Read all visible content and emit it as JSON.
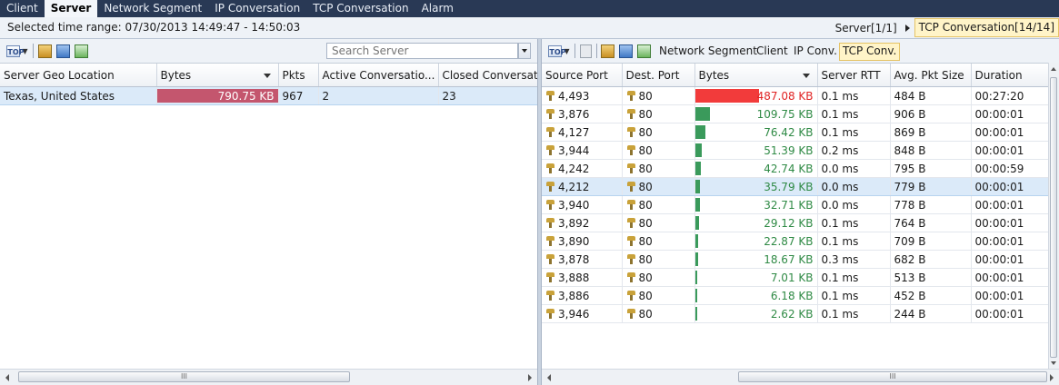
{
  "tabs": [
    {
      "label": "Client",
      "active": false
    },
    {
      "label": "Server",
      "active": true
    },
    {
      "label": "Network Segment",
      "active": false
    },
    {
      "label": "IP Conversation",
      "active": false
    },
    {
      "label": "TCP Conversation",
      "active": false
    },
    {
      "label": "Alarm",
      "active": false
    }
  ],
  "range_label": "Selected time range: 07/30/2013 14:49:47 - 14:50:03",
  "breadcrumbs": [
    "Server[1/1]",
    "TCP Conversation[14/14]"
  ],
  "left": {
    "search_placeholder": "Search Server",
    "columns": [
      "Server Geo Location",
      "Bytes",
      "Pkts",
      "Active Conversatio...",
      "Closed Conversations"
    ],
    "rows": [
      {
        "location": "Texas, United States",
        "bytes": "790.75 KB",
        "bytes_fraction": 1.0,
        "pkts": "967",
        "active": "2",
        "closed": "23"
      }
    ],
    "bar_color": "#c4566e",
    "hscroll_grip": "III"
  },
  "right": {
    "nav_tabs": [
      "Network Segment",
      "Client",
      "IP Conv.",
      "TCP Conv."
    ],
    "active_nav": "TCP Conv.",
    "columns": [
      "Source Port",
      "Dest. Port",
      "Bytes",
      "Server RTT",
      "Avg. Pkt Size",
      "Duration"
    ],
    "rows": [
      {
        "src": "4,493",
        "dst": "80",
        "bytes": "487.08 KB",
        "fraction": 1.0,
        "rtt": "0.1 ms",
        "avg": "484 B",
        "dur": "00:27:20",
        "highlight": true
      },
      {
        "src": "3,876",
        "dst": "80",
        "bytes": "109.75 KB",
        "fraction": 0.2253,
        "rtt": "0.1 ms",
        "avg": "906 B",
        "dur": "00:00:01"
      },
      {
        "src": "4,127",
        "dst": "80",
        "bytes": "76.42 KB",
        "fraction": 0.1569,
        "rtt": "0.1 ms",
        "avg": "869 B",
        "dur": "00:00:01"
      },
      {
        "src": "3,944",
        "dst": "80",
        "bytes": "51.39 KB",
        "fraction": 0.1055,
        "rtt": "0.2 ms",
        "avg": "848 B",
        "dur": "00:00:01"
      },
      {
        "src": "4,242",
        "dst": "80",
        "bytes": "42.74 KB",
        "fraction": 0.0877,
        "rtt": "0.0 ms",
        "avg": "795 B",
        "dur": "00:00:59"
      },
      {
        "src": "4,212",
        "dst": "80",
        "bytes": "35.79 KB",
        "fraction": 0.0735,
        "rtt": "0.0 ms",
        "avg": "779 B",
        "dur": "00:00:01",
        "selected": true
      },
      {
        "src": "3,940",
        "dst": "80",
        "bytes": "32.71 KB",
        "fraction": 0.0672,
        "rtt": "0.0 ms",
        "avg": "778 B",
        "dur": "00:00:01"
      },
      {
        "src": "3,892",
        "dst": "80",
        "bytes": "29.12 KB",
        "fraction": 0.0598,
        "rtt": "0.1 ms",
        "avg": "764 B",
        "dur": "00:00:01"
      },
      {
        "src": "3,890",
        "dst": "80",
        "bytes": "22.87 KB",
        "fraction": 0.047,
        "rtt": "0.1 ms",
        "avg": "709 B",
        "dur": "00:00:01"
      },
      {
        "src": "3,878",
        "dst": "80",
        "bytes": "18.67 KB",
        "fraction": 0.0383,
        "rtt": "0.3 ms",
        "avg": "682 B",
        "dur": "00:00:01"
      },
      {
        "src": "3,888",
        "dst": "80",
        "bytes": "7.01 KB",
        "fraction": 0.0144,
        "rtt": "0.1 ms",
        "avg": "513 B",
        "dur": "00:00:01"
      },
      {
        "src": "3,886",
        "dst": "80",
        "bytes": "6.18 KB",
        "fraction": 0.0127,
        "rtt": "0.1 ms",
        "avg": "452 B",
        "dur": "00:00:01"
      },
      {
        "src": "3,946",
        "dst": "80",
        "bytes": "2.62 KB",
        "fraction": 0.0054,
        "rtt": "0.1 ms",
        "avg": "244 B",
        "dur": "00:00:01"
      }
    ],
    "highlight_color": "#f23b3b",
    "bar_color": "#3a9a5b",
    "hscroll_grip": "III"
  },
  "icons": [
    "top-filter-icon",
    "export-icon",
    "save-icon",
    "report-icon",
    "grid-icon",
    "port-icon"
  ]
}
